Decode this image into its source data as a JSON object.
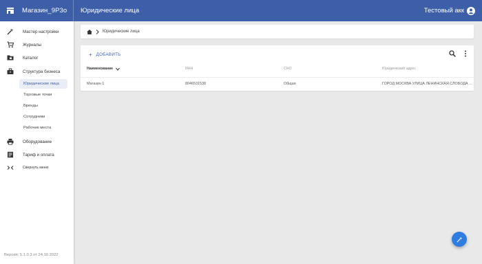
{
  "app": {
    "name": "Магазин_9Р3о",
    "page_title": "Юридические лица",
    "account": "Тестовый акк"
  },
  "sidebar": {
    "items": [
      {
        "label": "Мастер настройки",
        "icon": "wand-icon"
      },
      {
        "label": "Журналы",
        "icon": "cart-icon"
      },
      {
        "label": "Каталог",
        "icon": "folder-icon"
      },
      {
        "label": "Структура бизнеса",
        "icon": "briefcase-icon"
      }
    ],
    "sub_items": [
      {
        "label": "Юридические лица",
        "active": true
      },
      {
        "label": "Торговые точки"
      },
      {
        "label": "Бренды"
      },
      {
        "label": "Сотрудники"
      },
      {
        "label": "Рабочие места"
      }
    ],
    "bottom_items": [
      {
        "label": "Оборудование",
        "icon": "printer-icon"
      },
      {
        "label": "Тариф и оплата",
        "icon": "receipt-icon"
      },
      {
        "label": "Свернуть меню",
        "icon": "collapse-icon"
      }
    ],
    "version": "Версия: 5.1.0.3 от 24.10.2022"
  },
  "breadcrumb": {
    "current": "Юридические лица"
  },
  "toolbar": {
    "add_label": "ДОБАВИТЬ"
  },
  "table": {
    "columns": [
      "Наименование",
      "ИНН",
      "СНО",
      "Юридический адрес"
    ],
    "rows": [
      [
        "Магазин 1",
        "8046531538",
        "Общая",
        "ГОРОД МОСКВА УЛИЦА ЛЕНИНСКАЯ СЛОБОДА ..."
      ]
    ]
  },
  "colors": {
    "header": "#3d5fa8",
    "accent": "#2f7de1",
    "active_bg": "#e9edf6"
  }
}
